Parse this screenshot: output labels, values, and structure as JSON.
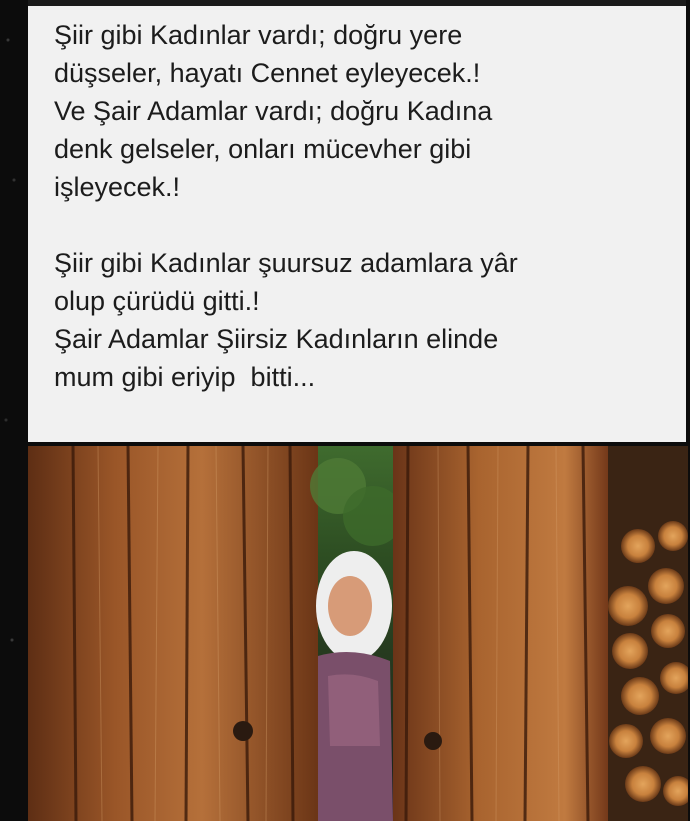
{
  "poem": {
    "stanza1": [
      "Şiir gibi Kadınlar vardı; doğru yere",
      "düşseler, hayatı Cennet eyleyecek.!",
      "Ve Şair Adamlar vardı; doğru Kadına",
      "denk gelseler, onları mücevher gibi",
      "işleyecek.!"
    ],
    "stanza2": [
      "Şiir gibi Kadınlar şuursuz adamlara yâr",
      "olup çürüdü gitti.!",
      "Şair Adamlar Şiirsiz Kadınların elinde",
      "mum gibi eriyip  bitti..."
    ]
  },
  "colors": {
    "card_background": "#f1f1f1",
    "text": "#1c1c1c",
    "frame": "#0c0c0c",
    "wood": "#8a4a22"
  }
}
